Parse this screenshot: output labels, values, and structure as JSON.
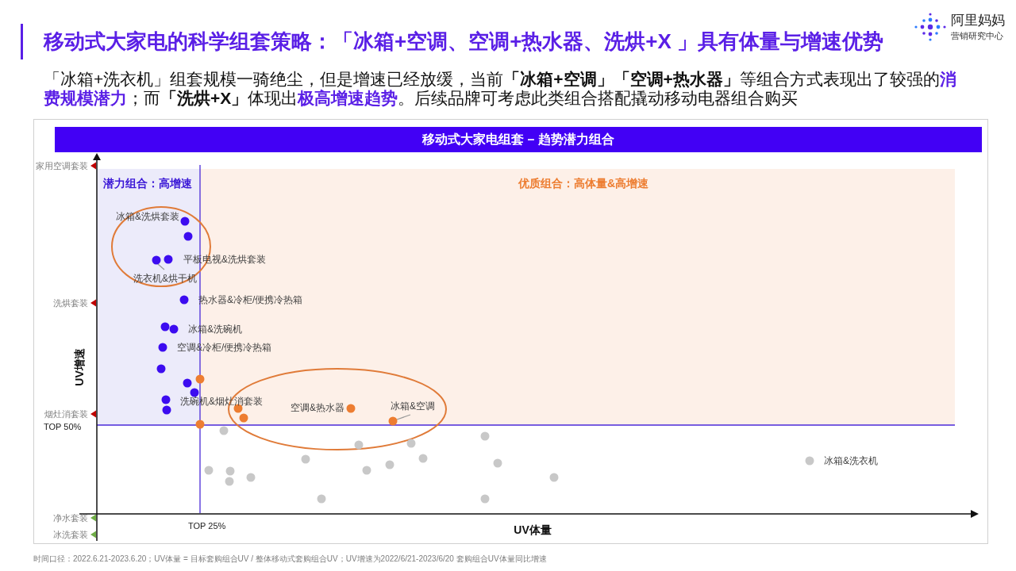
{
  "header": {
    "title": "移动式大家电的科学组套策略：「冰箱+空调、空调+热水器、洗烘+X 」具有体量与增速优势",
    "logo": {
      "name": "阿里妈妈",
      "subtitle": "营销研究中心"
    }
  },
  "summary": [
    {
      "kind": "plain",
      "text": "「冰箱+洗衣机」组套规模一骑绝尘，但是增速已经放缓，当前"
    },
    {
      "kind": "bold",
      "text": "「冰箱+空调」「空调+热水器」"
    },
    {
      "kind": "plain",
      "text": "等组合方式表现出了较强的"
    },
    {
      "kind": "accent",
      "text": "消费规模潜力"
    },
    {
      "kind": "plain",
      "text": "；而"
    },
    {
      "kind": "bold",
      "text": "「洗烘+X」"
    },
    {
      "kind": "plain",
      "text": "体现出"
    },
    {
      "kind": "accent",
      "text": "极高增速趋势"
    },
    {
      "kind": "plain",
      "text": "。后续品牌可考虑此类组合搭配撬动移动电器组合购买"
    }
  ],
  "chart": {
    "title": "移动式大家电组套 – 趋势潜力组合",
    "x_axis_label": "UV体量",
    "y_axis_label": "UV增速",
    "quadrants": [
      {
        "kind": "potential",
        "label": "潜力组合：高增速"
      },
      {
        "kind": "quality",
        "label": "优质组合：高体量&高增速"
      }
    ],
    "thresholds": [
      {
        "kind": "horizontal",
        "label": "TOP 50%"
      },
      {
        "kind": "vertical",
        "label": "TOP 25%"
      }
    ],
    "y_markers": [
      {
        "label": "家用空调套装",
        "color": "#c00000"
      },
      {
        "label": "洗烘套装",
        "color": "#c00000"
      },
      {
        "label": "烟灶消套装",
        "color": "#c00000"
      },
      {
        "label": "净水套装",
        "color": "#70ad47"
      },
      {
        "label": "冰洗套装",
        "color": "#70ad47"
      }
    ],
    "points": [
      {
        "label": "冰箱&洗烘套装",
        "color": "#3c0cf0"
      },
      {
        "color": "#3c0cf0"
      },
      {
        "label": "洗衣机&烘干机",
        "color": "#3c0cf0"
      },
      {
        "label": "平板电视&洗烘套装",
        "color": "#3c0cf0"
      },
      {
        "label": "热水器&冷柜/便携冷热箱",
        "color": "#3c0cf0"
      },
      {
        "color": "#3c0cf0"
      },
      {
        "label": "冰箱&洗碗机",
        "color": "#3c0cf0"
      },
      {
        "label": "空调&冷柜/便携冷热箱",
        "color": "#3c0cf0"
      },
      {
        "color": "#3c0cf0"
      },
      {
        "color": "#3c0cf0"
      },
      {
        "color": "#3c0cf0"
      },
      {
        "label": "洗碗机&烟灶消套装",
        "color": "#3c0cf0"
      },
      {
        "color": "#3c0cf0"
      },
      {
        "color": "#ed7d31"
      },
      {
        "color": "#ed7d31"
      },
      {
        "color": "#ed7d31"
      },
      {
        "color": "#ed7d31"
      },
      {
        "label": "空调&热水器",
        "color": "#ed7d31"
      },
      {
        "label": "冰箱&空调",
        "color": "#ed7d31"
      },
      {
        "color": "#c8c8c8"
      },
      {
        "color": "#c8c8c8"
      },
      {
        "color": "#c8c8c8"
      },
      {
        "color": "#c8c8c8"
      },
      {
        "color": "#c8c8c8"
      },
      {
        "color": "#c8c8c8"
      },
      {
        "color": "#c8c8c8"
      },
      {
        "color": "#c8c8c8"
      },
      {
        "color": "#c8c8c8"
      },
      {
        "color": "#c8c8c8"
      },
      {
        "color": "#c8c8c8"
      },
      {
        "color": "#c8c8c8"
      },
      {
        "color": "#c8c8c8"
      },
      {
        "color": "#c8c8c8"
      },
      {
        "color": "#c8c8c8"
      },
      {
        "color": "#c8c8c8"
      },
      {
        "label": "冰箱&洗衣机",
        "color": "#c8c8c8"
      }
    ]
  },
  "footnote": "时间口径：2022.6.21-2023.6.20；UV体量 = 目标套购组合UV / 整体移动式套购组合UV；UV增速为2022/6/21-2023/6/20 套购组合UV体量同比增速"
}
